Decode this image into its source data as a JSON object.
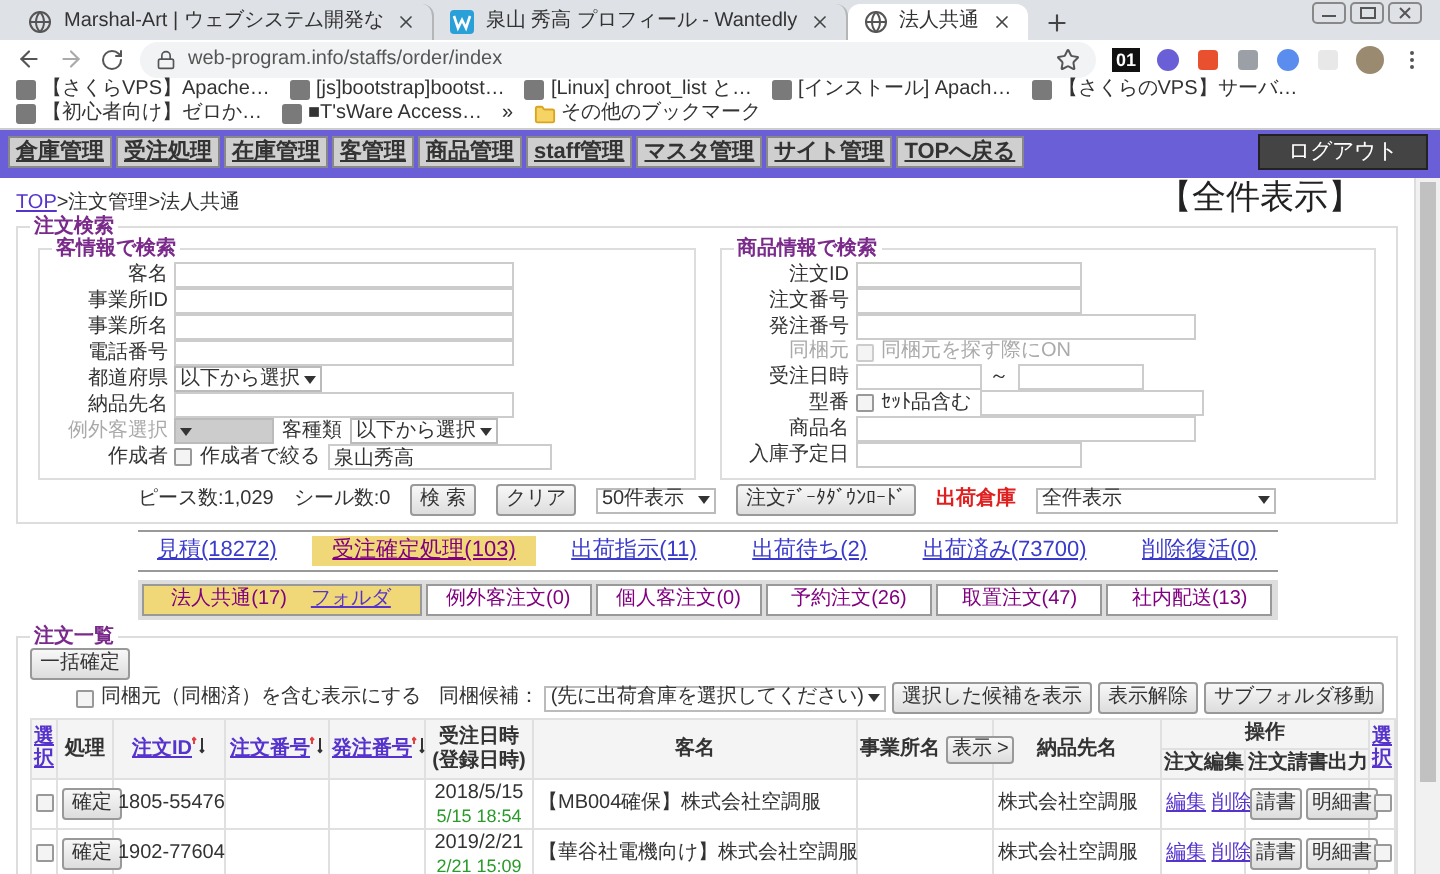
{
  "browser": {
    "tabs": [
      {
        "title": "Marshal-Art | ウェブシステム開発な",
        "kind": "globe",
        "selected": false
      },
      {
        "title": "泉山 秀高 プロフィール - Wantedly",
        "kind": "logo",
        "selected": false
      },
      {
        "title": "法人共通",
        "kind": "globe",
        "selected": true
      }
    ],
    "url": "web-program.info/staffs/order/index",
    "extension_badge": "01",
    "bookmarks": [
      "【さくらVPS】Apache…",
      "[js]bootstrap]bootst…",
      "[Linux] chroot_list と…",
      "[インストール] Apach…",
      "【さくらのVPS】サーバ…",
      "【初心者向け】ゼロか…",
      "■T'sWare Access…"
    ],
    "bookmarks_more": "»",
    "other_bookmarks": "その他のブックマーク"
  },
  "nav": {
    "items": [
      "倉庫管理",
      "受注処理",
      "在庫管理",
      "客管理",
      "商品管理",
      "staff管理",
      "マスタ管理",
      "サイト管理",
      "TOPへ戻る"
    ],
    "logout": "ログアウト"
  },
  "breadcrumb": {
    "link": "TOP",
    "trail": ">注文管理>法人共通"
  },
  "view_title": "【全件表示】",
  "search": {
    "legend": "注文検索",
    "customer": {
      "legend": "客情報で検索",
      "fields": [
        {
          "kind": "text",
          "label": "客名",
          "disabled": false
        },
        {
          "kind": "text",
          "label": "事業所ID",
          "disabled": false
        },
        {
          "kind": "text",
          "label": "事業所名",
          "disabled": false
        },
        {
          "kind": "text",
          "label": "電話番号",
          "disabled": false
        },
        {
          "kind": "select",
          "label": "都道府県",
          "value": "以下から選択",
          "disabled": false
        },
        {
          "kind": "text",
          "label": "納品先名",
          "disabled": false
        },
        {
          "kind": "pair",
          "label": "例外客選択",
          "disabled": true,
          "label_2": "客種類",
          "value_2": "以下から選択"
        },
        {
          "kind": "check_text",
          "label": "作成者",
          "check_label": "作成者で絞る",
          "checked": false,
          "value": "泉山秀高",
          "disabled": false
        }
      ]
    },
    "product": {
      "legend": "商品情報で検索",
      "fields": [
        {
          "kind": "short",
          "label": "注文ID",
          "disabled": false
        },
        {
          "kind": "short",
          "label": "注文番号",
          "disabled": false
        },
        {
          "kind": "text",
          "label": "発注番号",
          "disabled": false
        },
        {
          "kind": "check",
          "label": "同梱元",
          "check_label": "同梱元を探す際にON",
          "checked": false,
          "disabled": true
        },
        {
          "kind": "range",
          "label": "受注日時",
          "separator": "～",
          "disabled": false
        },
        {
          "kind": "check_text",
          "label": "型番",
          "check_label": "ｾｯﾄ品含む",
          "checked": false,
          "disabled": false
        },
        {
          "kind": "text",
          "label": "商品名",
          "disabled": false
        },
        {
          "kind": "short",
          "label": "入庫予定日",
          "disabled": false
        }
      ]
    },
    "summary": {
      "pieces": "ピース数:1,029",
      "seals": "シール数:0",
      "search_button": "検 索",
      "clear_button": "クリア",
      "per_page": "50件表示",
      "download_button": "注文ﾃﾞｰﾀﾀﾞｳﾝﾛｰﾄﾞ",
      "warehouse_label": "出荷倉庫",
      "warehouse": "全件表示"
    }
  },
  "status_tabs": [
    {
      "label": "見積(18272)",
      "selected": false
    },
    {
      "label": "受注確定処理(103)",
      "selected": true
    },
    {
      "label": "出荷指示(11)",
      "selected": false
    },
    {
      "label": "出荷待ち(2)",
      "selected": false
    },
    {
      "label": "出荷済み(73700)",
      "selected": false
    },
    {
      "label": "削除復活(0)",
      "selected": false
    }
  ],
  "folder_tabs": [
    {
      "label": "法人共通(17)",
      "link": "フォルダ",
      "selected": true
    },
    {
      "label": "例外客注文(0)",
      "selected": false
    },
    {
      "label": "個人客注文(0)",
      "selected": false
    },
    {
      "label": "予約注文(26)",
      "selected": false
    },
    {
      "label": "取置注文(47)",
      "selected": false
    },
    {
      "label": "社内配送(13)",
      "selected": false
    }
  ],
  "list": {
    "legend": "注文一覧",
    "bulk_button": "一括確定",
    "include_bundled": {
      "label": "同梱元（同梱済）を含む表示にする",
      "checked": false
    },
    "bundle_label": "同梱候補：",
    "bundle_select": "(先に出荷倉庫を選択してください)",
    "buttons": [
      "選択した候補を表示",
      "表示解除",
      "サブフォルダ移動"
    ],
    "columns": [
      {
        "kind": "link",
        "label": "選択"
      },
      {
        "kind": "plain",
        "label": "処理"
      },
      {
        "kind": "sort",
        "label": "注文ID"
      },
      {
        "kind": "sort",
        "label": "注文番号"
      },
      {
        "kind": "sort",
        "label": "発注番号"
      },
      {
        "kind": "two_line",
        "label": "受注日時",
        "sub_label": "(登録日時)"
      },
      {
        "kind": "plain",
        "label": "客名"
      },
      {
        "kind": "button",
        "label": "事業所名",
        "button": "表示 >"
      },
      {
        "kind": "plain",
        "label": "納品先名"
      },
      {
        "kind": "group",
        "label": "操作",
        "children": [
          "注文編集",
          "注文請書出力"
        ]
      },
      {
        "kind": "link",
        "label": "選択"
      }
    ],
    "rows": [
      {
        "checked": false,
        "action": "確定",
        "order_id": "1805-55476",
        "date": "2018/5/15",
        "registered": "5/15 18:54",
        "customer": "【MB004確保】株式会社空調服",
        "delivery": "株式会社空調服",
        "edit": "編集",
        "delete": "削除",
        "documents": [
          "請書",
          "明細書"
        ],
        "checked_end": false
      },
      {
        "checked": false,
        "action": "確定",
        "order_id": "1902-77604",
        "date": "2019/2/21",
        "registered": "2/21 15:09",
        "customer": "【華谷社電機向け】株式会社空調服",
        "delivery": "株式会社空調服",
        "edit": "編集",
        "delete": "削除",
        "documents": [
          "請書",
          "明細書"
        ],
        "checked_end": false
      }
    ]
  }
}
